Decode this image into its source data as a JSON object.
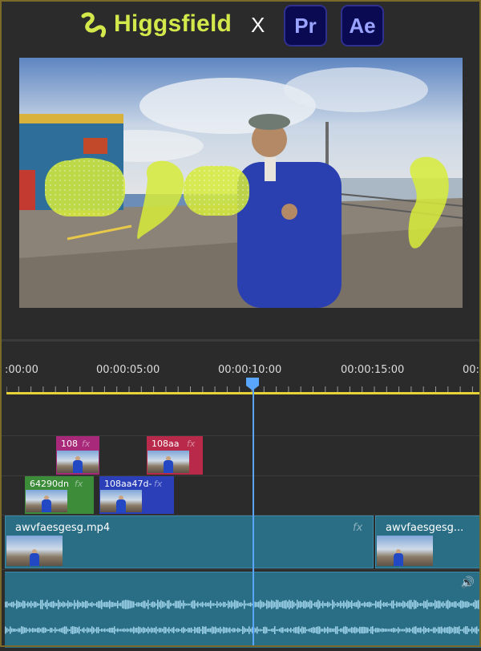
{
  "header": {
    "brand": "Higgsfield",
    "separator": "X",
    "apps": [
      "Pr",
      "Ae"
    ]
  },
  "colors": {
    "brand_lime": "#d3e84a",
    "playhead": "#5aa6ff",
    "work_area": "#e8d23a",
    "video_track": "#2a6e86",
    "app_badge": "#0a0a52"
  },
  "timeline": {
    "timecodes": [
      ":00:00",
      "00:00:05:00",
      "00:00:10:00",
      "00:00:15:00",
      "00:"
    ],
    "playhead_seconds": 10
  },
  "clips": {
    "magenta": {
      "name": "108",
      "fx": "fx"
    },
    "red": {
      "name": "108aa",
      "fx": "fx"
    },
    "green": {
      "name": "64290dn",
      "fx": "fx"
    },
    "blue": {
      "name": "108aa47d-",
      "fx": "fx"
    },
    "main": {
      "name": "awvfaesgesg.mp4",
      "fx": "fx"
    },
    "main2": {
      "name": "awvfaesgesg..."
    }
  },
  "icons": {
    "logo": "higgsfield-logo-icon",
    "speaker": "speaker-icon"
  }
}
